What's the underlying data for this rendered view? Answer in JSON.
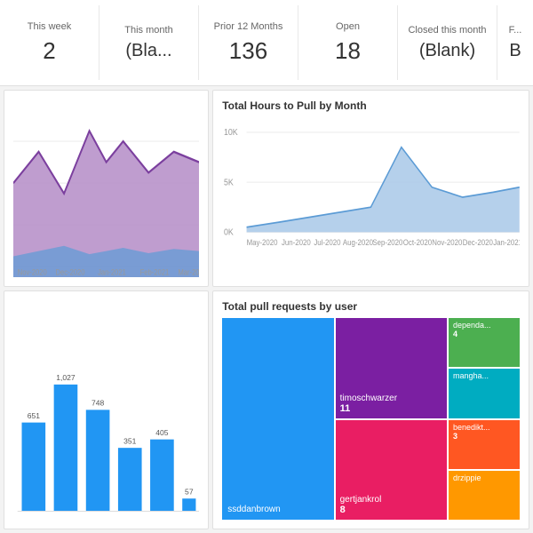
{
  "stats": [
    {
      "label": "This week",
      "value": "2",
      "id": "this-week"
    },
    {
      "label": "This month",
      "value": "(Bla...",
      "id": "this-month"
    },
    {
      "label": "Prior 12 Months",
      "value": "136",
      "id": "prior-months"
    },
    {
      "label": "Open",
      "value": "18",
      "id": "open"
    },
    {
      "label": "Closed this month",
      "value": "(Blank)",
      "id": "closed-month"
    },
    {
      "label": "F...",
      "value": "B",
      "id": "extra"
    }
  ],
  "charts": {
    "top_left": {
      "title": "",
      "colors": [
        "#7B3F9E",
        "#B48CC7",
        "#5B9BD5"
      ]
    },
    "top_right": {
      "title": "Total Hours to Pull by Month",
      "y_labels": [
        "10K",
        "5K",
        "0K"
      ],
      "x_labels": [
        "May-2020",
        "Jun-2020",
        "Jul-2020",
        "Aug-2020",
        "Sep-2020",
        "Oct-2020",
        "Nov-2020",
        "Dec-2020",
        "Jan-2021"
      ],
      "color": "#A8C8E8"
    },
    "bottom_left": {
      "title": "",
      "bars": [
        {
          "label": "",
          "value": 651
        },
        {
          "label": "",
          "value": 1027
        },
        {
          "label": "",
          "value": 748
        },
        {
          "label": "",
          "value": 351
        },
        {
          "label": "",
          "value": 405
        },
        {
          "label": "",
          "value": 57
        }
      ]
    },
    "bottom_right": {
      "title": "Total pull requests by user",
      "cells": [
        {
          "name": "ssddanbrown",
          "count": "",
          "color": "#2196F3",
          "span": "large"
        },
        {
          "name": "timoschwarzer",
          "count": "11",
          "color": "#9C27B0"
        },
        {
          "name": "gertjankrol",
          "count": "8",
          "color": "#E91E63"
        },
        {
          "name": "dependa",
          "count": "4",
          "color": "#4CAF50"
        },
        {
          "name": "mangha...",
          "count": "",
          "color": "#00BCD4"
        },
        {
          "name": "benedikt...",
          "count": "3",
          "color": "#FF5722"
        },
        {
          "name": "drzippie",
          "count": "",
          "color": "#FF9800"
        }
      ]
    }
  }
}
